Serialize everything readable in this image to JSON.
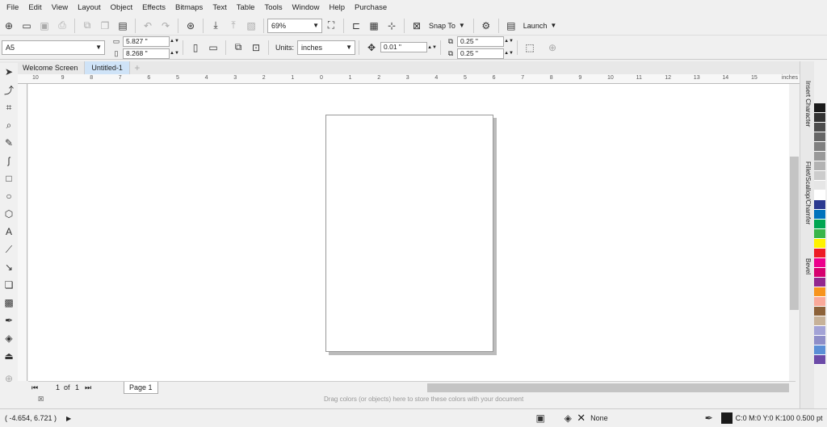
{
  "menu": [
    "File",
    "Edit",
    "View",
    "Layout",
    "Object",
    "Effects",
    "Bitmaps",
    "Text",
    "Table",
    "Tools",
    "Window",
    "Help",
    "Purchase"
  ],
  "toolbar": {
    "zoom": "69%",
    "snap": "Snap To",
    "launch": "Launch"
  },
  "props": {
    "page_size": "A5",
    "width": "5.827 \"",
    "height": "8.268 \"",
    "units_label": "Units:",
    "units": "inches",
    "nudge": "0.01 \"",
    "dup_x": "0.25 \"",
    "dup_y": "0.25 \""
  },
  "tabs": [
    "Welcome Screen",
    "Untitled-1"
  ],
  "ruler": {
    "unit": "inches",
    "ticks": [
      "10",
      "9",
      "8",
      "7",
      "6",
      "5",
      "4",
      "3",
      "2",
      "1",
      "0",
      "1",
      "2",
      "3",
      "4",
      "5",
      "6",
      "7",
      "8",
      "9",
      "10",
      "11",
      "12",
      "13",
      "14",
      "15"
    ]
  },
  "dockers": [
    "Insert Character",
    "Fillet/Scallop/Chamfer",
    "Bevel"
  ],
  "pagenav": {
    "current": "1",
    "of": "of",
    "total": "1",
    "page_tab": "Page 1"
  },
  "colordock": {
    "hint": "Drag colors (or objects) here to store these colors with your document"
  },
  "status": {
    "coords": "( -4.654, 6.721 )",
    "fill": "None",
    "outline": "C:0 M:0 Y:0 K:100  0.500 pt"
  },
  "palette": [
    "#1a1a1a",
    "#333333",
    "#4d4d4d",
    "#666666",
    "#808080",
    "#999999",
    "#b3b3b3",
    "#cccccc",
    "#e6e6e6",
    "#ffffff",
    "#2b3990",
    "#0072bc",
    "#00a651",
    "#39b54a",
    "#fff200",
    "#ed1c24",
    "#ec008c",
    "#d6006f",
    "#92278f",
    "#f7941d",
    "#f9a99a",
    "#8c6239",
    "#c7b299",
    "#a3a3d6",
    "#8e8ec8",
    "#5b8fd6",
    "#6c4ba8"
  ]
}
